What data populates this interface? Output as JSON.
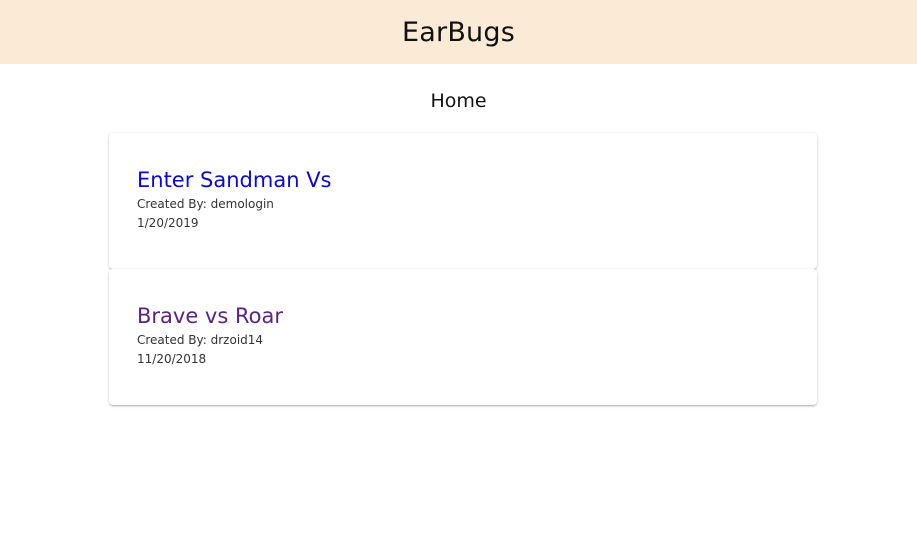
{
  "header": {
    "title": "EarBugs",
    "background": "#fbebd6"
  },
  "main": {
    "page_title": "Home",
    "cards": [
      {
        "title": "Enter Sandman Vs",
        "created_by": "Created By: demologin",
        "date": "1/20/2019",
        "link_color": "#0b07d6"
      },
      {
        "title": "Brave vs Roar",
        "created_by": "Created By: drzoid14",
        "date": "11/20/2018",
        "link_color": "#5b2283"
      }
    ]
  }
}
